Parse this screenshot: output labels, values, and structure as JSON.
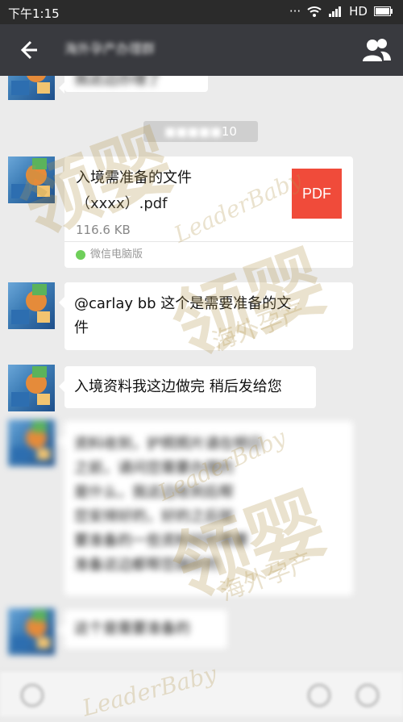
{
  "status": {
    "time": "下午1:15",
    "network": "HD"
  },
  "header": {
    "title": "海外孕产办理群",
    "back_icon": "back-arrow-icon",
    "group_icon": "group-members-icon"
  },
  "messages": {
    "top_partial_text": "我这边办理了",
    "time_badge": "10",
    "file": {
      "title": "入境需准备的文件",
      "name": "（xxxx）.pdf",
      "size": "116.6 KB",
      "type_label": "PDF",
      "source": "微信电脑版"
    },
    "msg2_line1": "@carlay bb 这个是需要准备的文",
    "msg2_line2": "件",
    "msg3": "入境资料我这边做完 稍后发给您",
    "blurred_long": [
      "资料收到，护照照片请在明日",
      "之前，请问您需要办理的",
      "是什么，我这边收到后帮",
      "您安排好的，好的之后就",
      "要准备的一些资料好的需要",
      "准备这边都帮您搞好的"
    ],
    "blurred_short": "这个是需要准备的"
  },
  "watermark": {
    "brand_cn": "领婴",
    "brand_en": "LeaderBaby",
    "tagline": "海外孕产"
  }
}
